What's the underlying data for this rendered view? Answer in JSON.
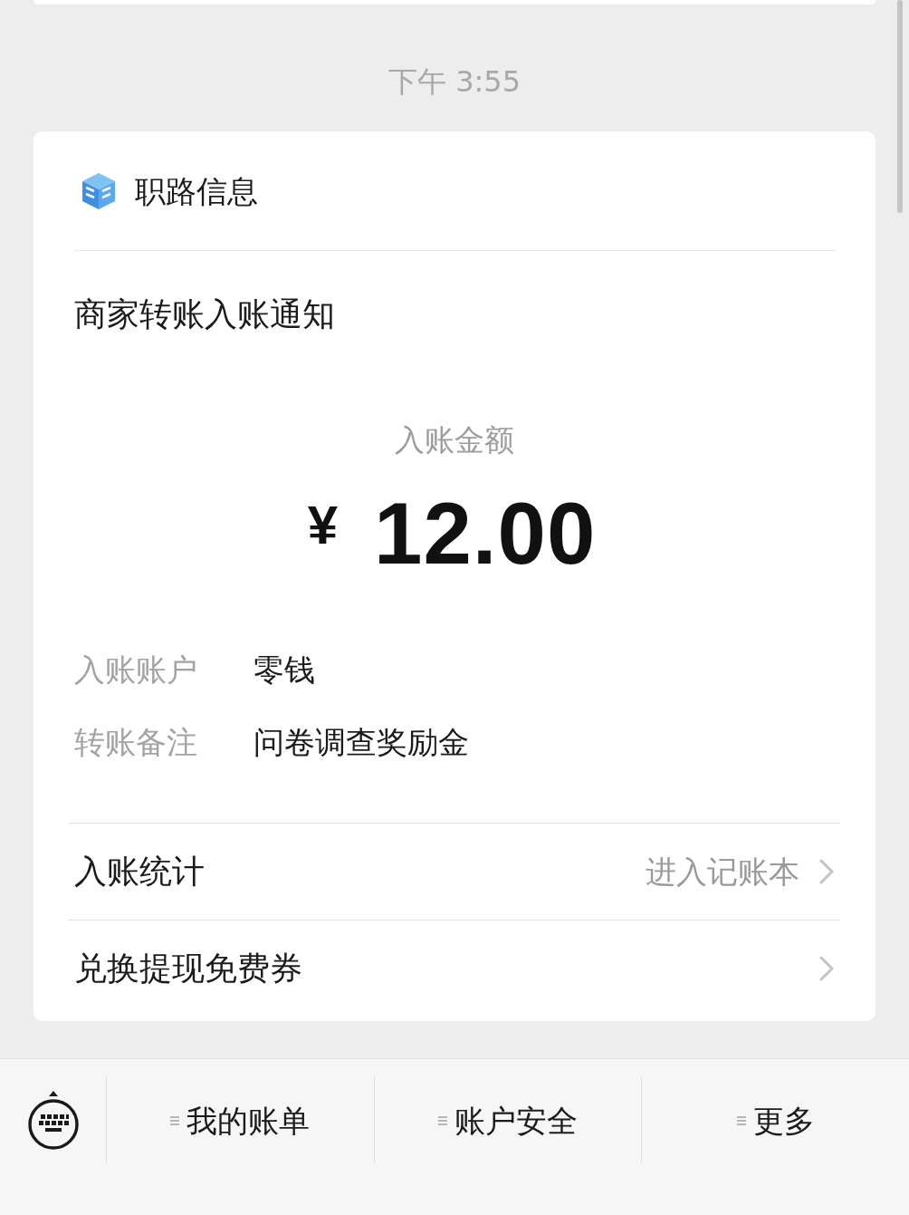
{
  "timestamp": "下午 3:55",
  "card": {
    "account": {
      "name": "职路信息"
    },
    "title": "商家转账入账通知",
    "amount": {
      "label": "入账金额",
      "currency": "¥",
      "value": "12.00"
    },
    "details": [
      {
        "label": "入账账户",
        "value": "零钱"
      },
      {
        "label": "转账备注",
        "value": "问卷调查奖励金"
      }
    ],
    "links": [
      {
        "label": "入账统计",
        "hint": "进入记账本"
      },
      {
        "label": "兑换提现免费券"
      }
    ]
  },
  "menu_bar": {
    "items": [
      {
        "label": "我的账单"
      },
      {
        "label": "账户安全"
      },
      {
        "label": "更多"
      }
    ]
  }
}
